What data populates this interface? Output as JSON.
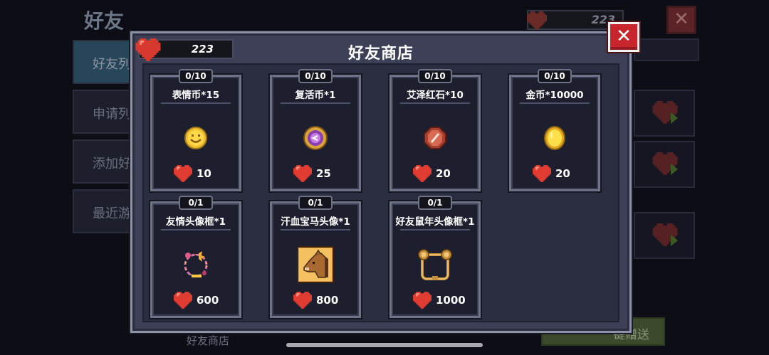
{
  "background": {
    "title": "好友",
    "sidebar": [
      "好友列表",
      "申请列表",
      "添加好友",
      "最近游戏"
    ],
    "heart_count": "223",
    "bottom_label": "好友商店",
    "send_button": "一键赠送"
  },
  "shop": {
    "title": "好友商店",
    "heart_count": "223",
    "items": [
      {
        "name": "表情币*15",
        "limit": "0/10",
        "price": "10",
        "icon": "smiley-coin-icon"
      },
      {
        "name": "复活币*1",
        "limit": "0/10",
        "price": "25",
        "icon": "revive-coin-icon"
      },
      {
        "name": "艾泽红石*10",
        "limit": "0/10",
        "price": "20",
        "icon": "red-stone-icon"
      },
      {
        "name": "金币*10000",
        "limit": "0/10",
        "price": "20",
        "icon": "gold-coin-icon"
      },
      {
        "name": "友情头像框*1",
        "limit": "0/1",
        "price": "600",
        "icon": "friendship-frame-icon"
      },
      {
        "name": "汗血宝马头像*1",
        "limit": "0/1",
        "price": "800",
        "icon": "horse-avatar-icon"
      },
      {
        "name": "好友鼠年头像框*1",
        "limit": "0/1",
        "price": "1000",
        "icon": "rat-year-frame-icon"
      }
    ]
  },
  "colors": {
    "heart": "#e03c32",
    "close": "#c8262c",
    "panel": "#3c3f55",
    "card": "#1d1f2e"
  }
}
